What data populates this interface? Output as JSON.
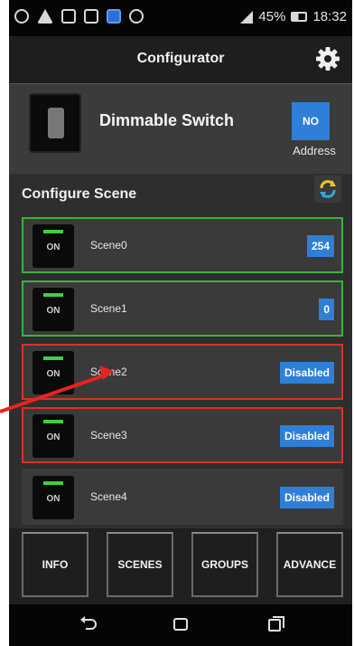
{
  "status_bar": {
    "battery": "45%",
    "time": "18:32"
  },
  "app_bar": {
    "title": "Configurator"
  },
  "device": {
    "name": "Dimmable Switch",
    "address_value": "NO",
    "address_label": "Address"
  },
  "configure_scene": {
    "title": "Configure Scene"
  },
  "scenes": [
    {
      "name": "Scene0",
      "value": "254",
      "thumb_text": "ON"
    },
    {
      "name": "Scene1",
      "value": "0",
      "thumb_text": "ON"
    },
    {
      "name": "Scene2",
      "value": "Disabled",
      "thumb_text": "ON"
    },
    {
      "name": "Scene3",
      "value": "Disabled",
      "thumb_text": "ON"
    },
    {
      "name": "Scene4",
      "value": "Disabled",
      "thumb_text": "ON"
    }
  ],
  "tabs": {
    "info": "INFO",
    "scenes": "SCENES",
    "groups": "GROUPS",
    "advance": "ADVANCE"
  },
  "colors": {
    "accent_blue": "#2f7fd8",
    "selected_green": "#3fb040",
    "highlight_red": "#d9302a"
  }
}
